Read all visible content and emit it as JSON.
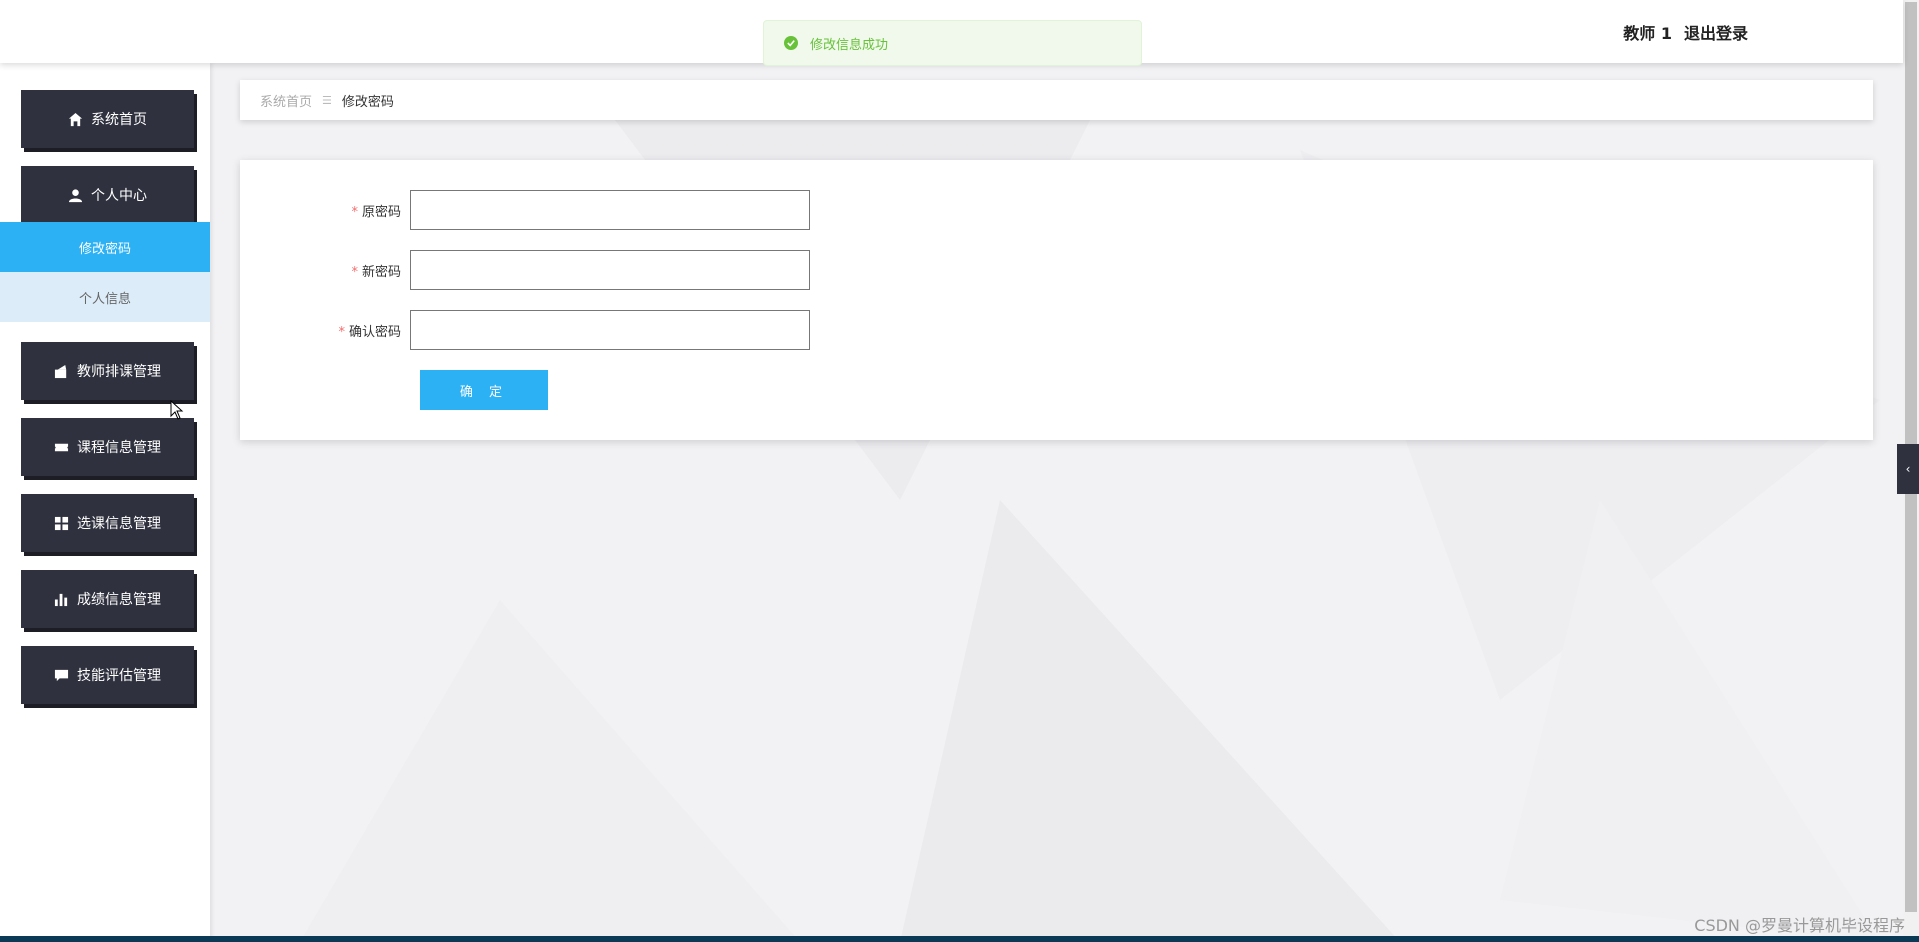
{
  "header": {
    "user": "教师 1",
    "logout": "退出登录"
  },
  "toast": {
    "message": "修改信息成功",
    "color": "#67c23a"
  },
  "sidebar": {
    "items": [
      {
        "label": "系统首页",
        "icon": "home-icon"
      },
      {
        "label": "个人中心",
        "icon": "user-icon"
      },
      {
        "label": "教师排课管理",
        "icon": "wallet-icon"
      },
      {
        "label": "课程信息管理",
        "icon": "ticket-icon"
      },
      {
        "label": "选课信息管理",
        "icon": "grid-icon"
      },
      {
        "label": "成绩信息管理",
        "icon": "bar-chart-icon"
      },
      {
        "label": "技能评估管理",
        "icon": "chat-icon"
      }
    ],
    "sub_items": [
      {
        "label": "修改密码",
        "active": true
      },
      {
        "label": "个人信息",
        "active": false
      }
    ],
    "accent": "#2db1f5",
    "button_color": "#2f313e"
  },
  "breadcrumb": {
    "home": "系统首页",
    "current": "修改密码"
  },
  "form": {
    "fields": [
      {
        "label": "原密码",
        "value": "",
        "required": true
      },
      {
        "label": "新密码",
        "value": "",
        "required": true
      },
      {
        "label": "确认密码",
        "value": "",
        "required": true
      }
    ],
    "submit_label": "确 定"
  },
  "watermark": "CSDN @罗曼计算机毕设程序"
}
